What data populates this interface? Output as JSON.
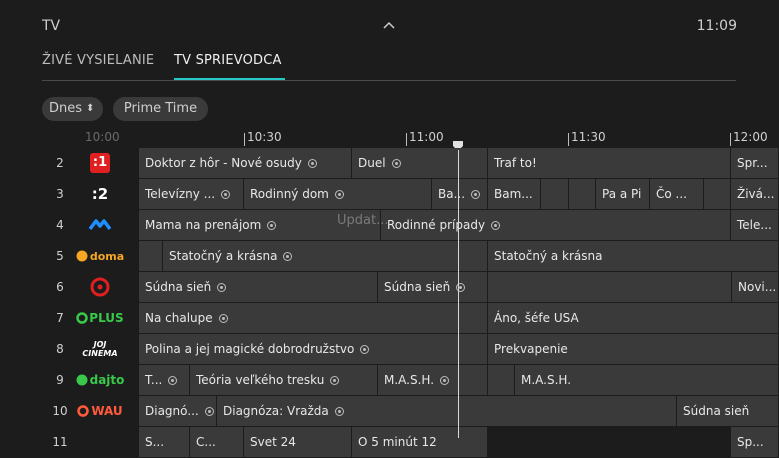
{
  "header": {
    "title": "TV",
    "clock": "11:09"
  },
  "tabs": [
    {
      "label": "ŽIVÉ VYSIELANIE"
    },
    {
      "label": "TV SPRIEVODCA"
    }
  ],
  "filters": {
    "day": "Dnes",
    "day_arrows": "⬍",
    "prime": "Prime Time"
  },
  "timeline": [
    {
      "label": "10:00"
    },
    {
      "label": "10:30"
    },
    {
      "label": "11:00"
    },
    {
      "label": "11:30"
    },
    {
      "label": "12:00"
    }
  ],
  "overlay": "Updat...",
  "channels": [
    {
      "num": "2",
      "logo": ":1",
      "cells": [
        "Doktor z hôr - Nové osudy",
        "Duel",
        "Traf to!",
        "Spr..."
      ]
    },
    {
      "num": "3",
      "logo": ":2",
      "cells": [
        "Televízny ...",
        "Rodinný dom",
        "Ba...",
        "Bam...",
        "",
        "Pa a Pi",
        "Čo ...",
        "",
        "Živá..."
      ]
    },
    {
      "num": "4",
      "logo": "",
      "cells": [
        "Mama na prenájom",
        "Rodinné prípady",
        "Tele..."
      ]
    },
    {
      "num": "5",
      "logo": "doma",
      "cells": [
        "",
        "Statočný a krásna",
        "Statočný a krásna"
      ]
    },
    {
      "num": "6",
      "logo": "",
      "cells": [
        "Súdna sieň",
        "Súdna sieň",
        "",
        "Novi..."
      ]
    },
    {
      "num": "7",
      "logo": "PLUS",
      "cells": [
        "Na chalupe",
        "Áno, šéfe USA"
      ]
    },
    {
      "num": "8",
      "logo": "JOJ CINEMA",
      "cells": [
        "Polina a jej magické dobrodružstvo",
        "Prekvapenie"
      ]
    },
    {
      "num": "9",
      "logo": "dajto",
      "cells": [
        "T...",
        "Teória veľkého tresku",
        "M.A.S.H.",
        "",
        "M.A.S.H."
      ]
    },
    {
      "num": "10",
      "logo": "WAU",
      "cells": [
        "Diagnó...",
        "Diagnóza: Vražda",
        "Súdna sieň"
      ]
    },
    {
      "num": "11",
      "logo": "",
      "cells": [
        "S...",
        "C...",
        "Svet 24",
        "O 5 minút 12",
        "Sp..."
      ]
    }
  ],
  "colors": {
    "accent": "#28c8c8",
    "cell": "#3a3a3a",
    "background": "#1c1c1c"
  }
}
